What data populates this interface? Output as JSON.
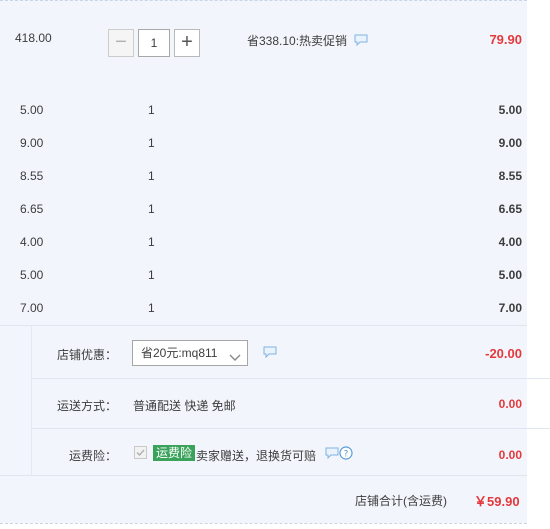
{
  "items": [
    {
      "unit_price": "418.00",
      "quantity": "1",
      "promo": "省338.10:热卖促销",
      "total": "79.90"
    },
    {
      "unit_price": "5.00",
      "quantity": "1",
      "total": "5.00"
    },
    {
      "unit_price": "9.00",
      "quantity": "1",
      "total": "9.00"
    },
    {
      "unit_price": "8.55",
      "quantity": "1",
      "total": "8.55"
    },
    {
      "unit_price": "6.65",
      "quantity": "1",
      "total": "6.65"
    },
    {
      "unit_price": "4.00",
      "quantity": "1",
      "total": "4.00"
    },
    {
      "unit_price": "5.00",
      "quantity": "1",
      "total": "5.00"
    },
    {
      "unit_price": "7.00",
      "quantity": "1",
      "total": "7.00"
    }
  ],
  "stepper": {
    "minus": "−",
    "plus": "+"
  },
  "discount": {
    "label": "店铺优惠：",
    "selected": "省20元:mq811",
    "amount": "-20.00"
  },
  "shipping": {
    "label": "运送方式：",
    "value": "普通配送 快递 免邮",
    "amount": "0.00"
  },
  "insurance": {
    "label": "运费险：",
    "badge": "运费险",
    "text": "卖家赠送，退换货可赔",
    "amount": "0.00"
  },
  "summary": {
    "label": "店铺合计(含运费)",
    "currency": "￥",
    "amount": "59.90"
  },
  "colors": {
    "price_red": "#e4393c",
    "bg": "#f2f6fc",
    "badge_green": "#3aa25a",
    "icon_blue": "#5b9bd5"
  },
  "icons": {
    "chat": "chat-bubble-icon",
    "help": "help-circle-icon",
    "check": "checkmark-icon",
    "chevron": "chevron-down-icon"
  }
}
